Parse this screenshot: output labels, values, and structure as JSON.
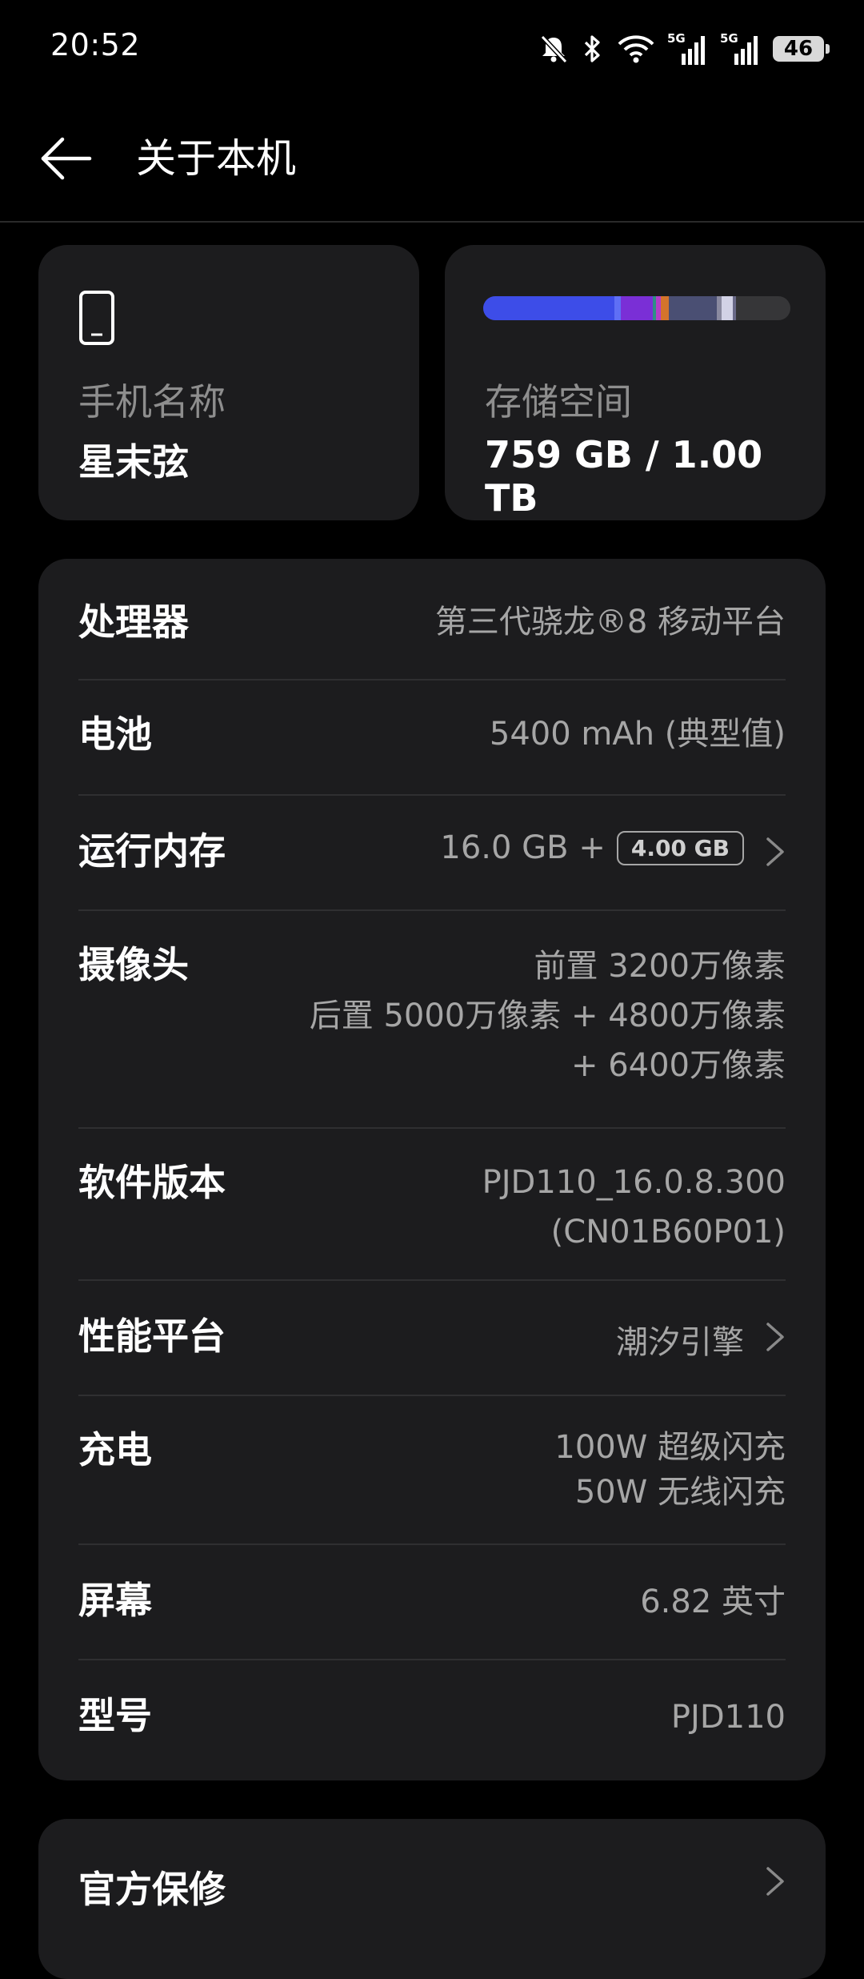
{
  "status_bar": {
    "time": "20:52",
    "battery": "46",
    "signal_labels": [
      "5G",
      "5G"
    ]
  },
  "header": {
    "title": "关于本机"
  },
  "device_card": {
    "label": "手机名称",
    "value": "星末弦"
  },
  "storage_card": {
    "label": "存储空间",
    "value": "759 GB / 1.00 TB",
    "used_fraction": 0.759
  },
  "specs": {
    "processor": {
      "label": "处理器",
      "value": "第三代骁龙®8 移动平台"
    },
    "battery": {
      "label": "电池",
      "value": "5400 mAh (典型值)"
    },
    "ram": {
      "label": "运行内存",
      "value": "16.0 GB +",
      "badge": "4.00 GB"
    },
    "camera": {
      "label": "摄像头",
      "lines": [
        "前置 3200万像素",
        "后置 5000万像素 + 4800万像素",
        "+ 6400万像素"
      ]
    },
    "software": {
      "label": "软件版本",
      "lines": [
        "PJD110_16.0.8.300",
        "(CN01B60P01)"
      ]
    },
    "performance": {
      "label": "性能平台",
      "value": "潮汐引擎"
    },
    "charging": {
      "label": "充电",
      "lines": [
        "100W 超级闪充",
        "50W 无线闪充"
      ]
    },
    "screen": {
      "label": "屏幕",
      "value": "6.82 英寸"
    },
    "model": {
      "label": "型号",
      "value": "PJD110"
    }
  },
  "warranty": {
    "label": "官方保修"
  },
  "colors": {
    "background": "#000000",
    "card": "#1c1c1e",
    "secondary_text": "#a6a6a6"
  }
}
